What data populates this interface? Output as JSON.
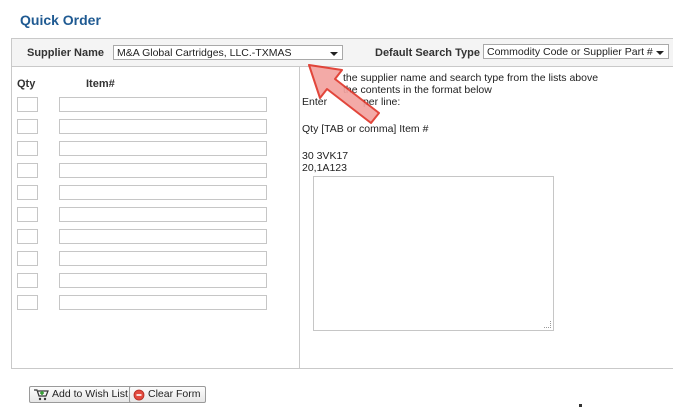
{
  "page": {
    "title": "Quick Order"
  },
  "toolbar": {
    "supplier_label": "Supplier Name",
    "supplier_value": "M&A Global Cartridges, LLC.-TXMAS",
    "search_type_label": "Default Search Type",
    "search_type_value": "Commodity Code or Supplier Part #"
  },
  "grid": {
    "qty_header": "Qty",
    "item_header": "Item#"
  },
  "instructions": {
    "line1": "the supplier name and search type from the lists above",
    "line2": "the contents in the format below",
    "line3a": "Enter",
    "line3b": "per line:",
    "line4": "Qty [TAB or comma] Item #",
    "example1": "30 3VK17",
    "example2": "20,1A123"
  },
  "buttons": {
    "add_wishlist": "Add to Wish List",
    "clear_form": "Clear Form"
  },
  "icons": {
    "add_wishlist": "cart-add-icon",
    "clear_form": "clear-icon",
    "annotation": "red-arrow-icon"
  },
  "colors": {
    "title": "#1f5a92",
    "arrow_fill": "#f2a3a0",
    "arrow_stroke": "#e0372b"
  }
}
